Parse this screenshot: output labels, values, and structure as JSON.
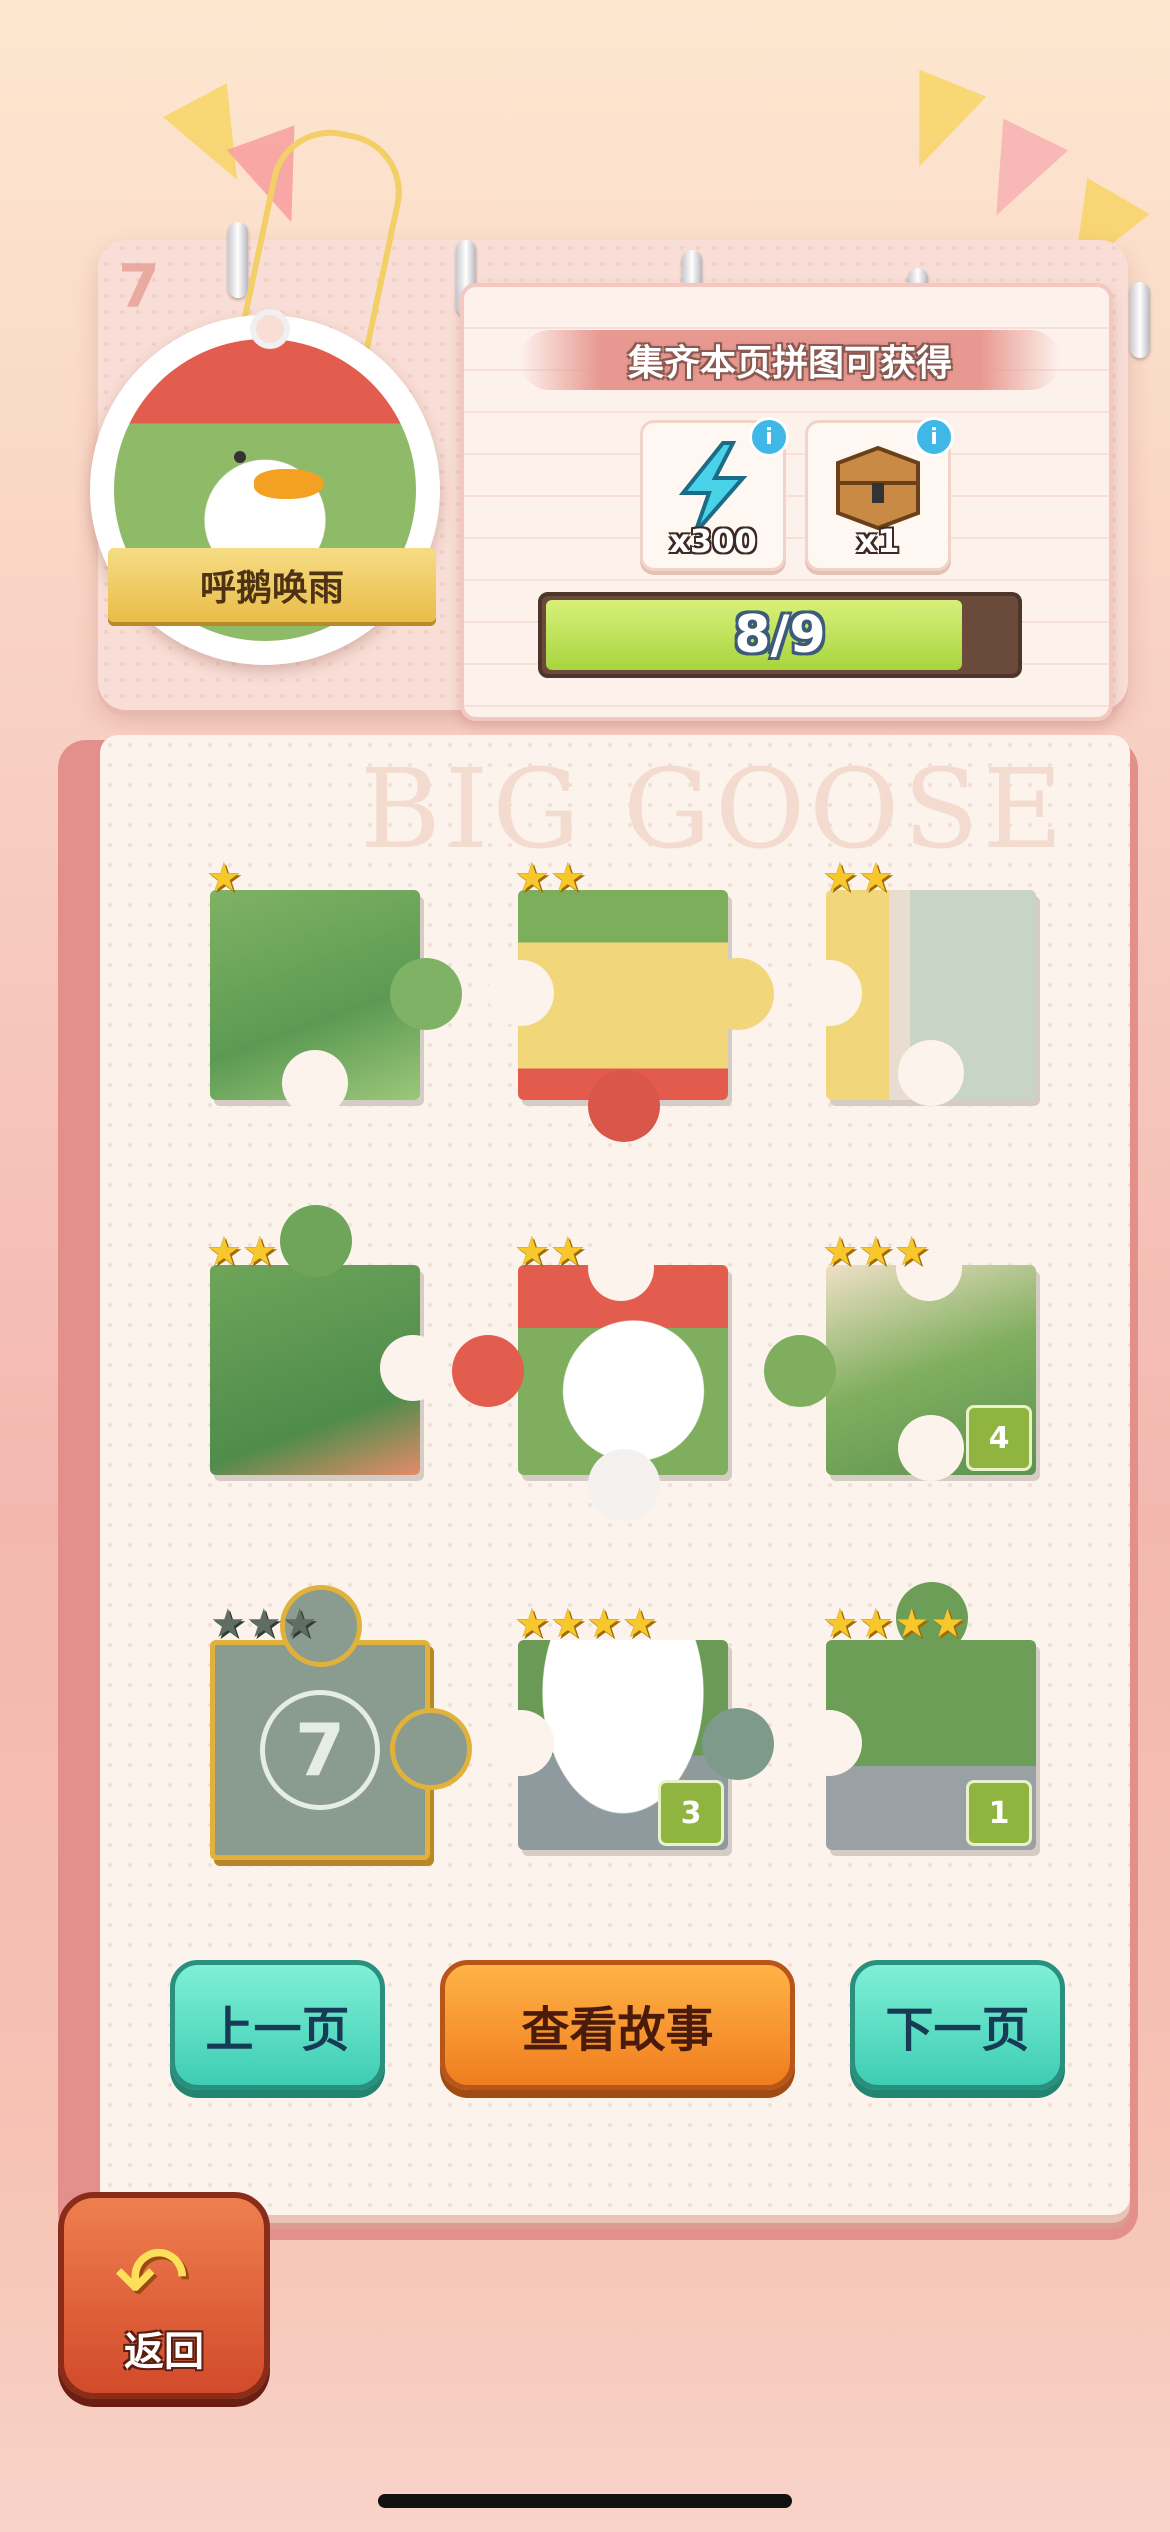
{
  "header": {
    "page_number": "7",
    "badge_title": "呼鹅唤雨",
    "reward_title": "集齐本页拼图可获得",
    "rewards": [
      {
        "icon": "lightning-icon",
        "quantity": "x300"
      },
      {
        "icon": "treasure-chest-icon",
        "quantity": "x1"
      }
    ],
    "info_icon_text": "i",
    "progress": {
      "text": "8/9",
      "fraction": 0.889
    }
  },
  "watermark": "BIG GOOSE",
  "pieces": [
    {
      "stars": "★",
      "stars_count": 1,
      "badge": ""
    },
    {
      "stars": "★★",
      "stars_count": 2,
      "badge": ""
    },
    {
      "stars": "★★",
      "stars_count": 2,
      "badge": ""
    },
    {
      "stars": "★★",
      "stars_count": 2,
      "badge": ""
    },
    {
      "stars": "★★",
      "stars_count": 2,
      "badge": ""
    },
    {
      "stars": "★★★",
      "stars_count": 3,
      "badge": "4"
    },
    {
      "stars": "★★★",
      "stars_count": 3,
      "badge": "",
      "locked_number": "7"
    },
    {
      "stars": "★★★★",
      "stars_count": 4,
      "badge": "3"
    },
    {
      "stars": "★★★★",
      "stars_count": 4,
      "badge": "1"
    }
  ],
  "buttons": {
    "prev": "上一页",
    "story": "查看故事",
    "next": "下一页",
    "back": "返回"
  },
  "colors": {
    "accent_teal": "#3ecdb4",
    "accent_orange": "#f07d1f",
    "star_gold": "#f7c72b",
    "progress_green": "#a8d53e",
    "locked_piece": "#8a9b90"
  }
}
